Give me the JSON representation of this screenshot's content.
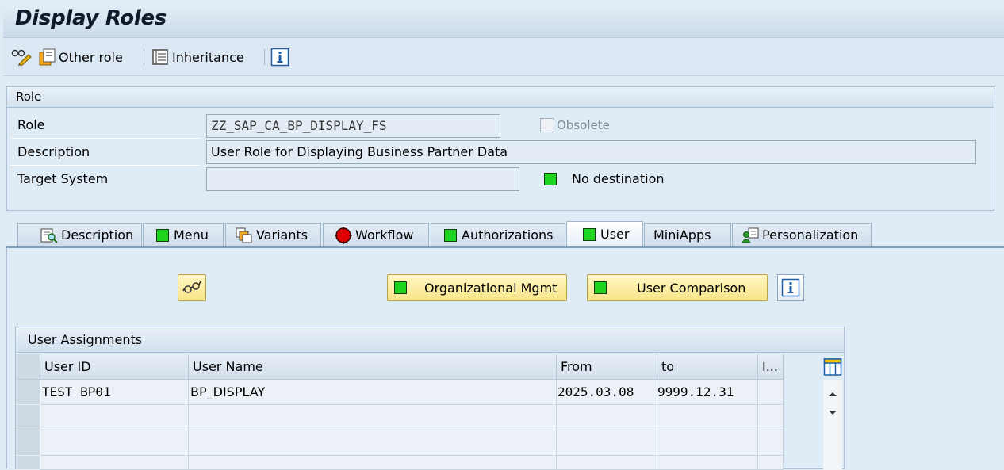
{
  "title": "Display Roles",
  "toolbar": {
    "other_role_label": "Other role",
    "inheritance_label": "Inheritance"
  },
  "role_group": {
    "header": "Role",
    "role_label": "Role",
    "role_value": "ZZ_SAP_CA_BP_DISPLAY_FS",
    "obsolete_label": "Obsolete",
    "description_label": "Description",
    "description_value": "User Role for Displaying Business Partner Data",
    "target_system_label": "Target System",
    "target_system_value": "",
    "destination_status": "No destination"
  },
  "tabs": [
    {
      "label": "Description",
      "icon": "description-icon",
      "active": false
    },
    {
      "label": "Menu",
      "icon": "green-status-icon",
      "active": false
    },
    {
      "label": "Variants",
      "icon": "variants-icon",
      "active": false
    },
    {
      "label": "Workflow",
      "icon": "red-status-icon",
      "active": false
    },
    {
      "label": "Authorizations",
      "icon": "green-status-icon",
      "active": false
    },
    {
      "label": "User",
      "icon": "green-status-icon",
      "active": true
    },
    {
      "label": "MiniApps",
      "icon": "",
      "active": false
    },
    {
      "label": "Personalization",
      "icon": "personalization-icon",
      "active": false
    }
  ],
  "user_tab": {
    "org_mgmt_label": "Organizational Mgmt",
    "user_comparison_label": "User Comparison"
  },
  "user_assignments": {
    "caption": "User Assignments",
    "columns": [
      "User ID",
      "User Name",
      "From",
      "to",
      "I..."
    ],
    "rows": [
      {
        "user_id": "TEST_BP01",
        "user_name": "BP_DISPLAY",
        "from": "2025.03.08",
        "to": "9999.12.31"
      }
    ]
  },
  "colors": {
    "background": "#dfebf5",
    "status_green": "#1fd41f",
    "status_red": "#e00000",
    "button_yellow": "#f7e488"
  }
}
